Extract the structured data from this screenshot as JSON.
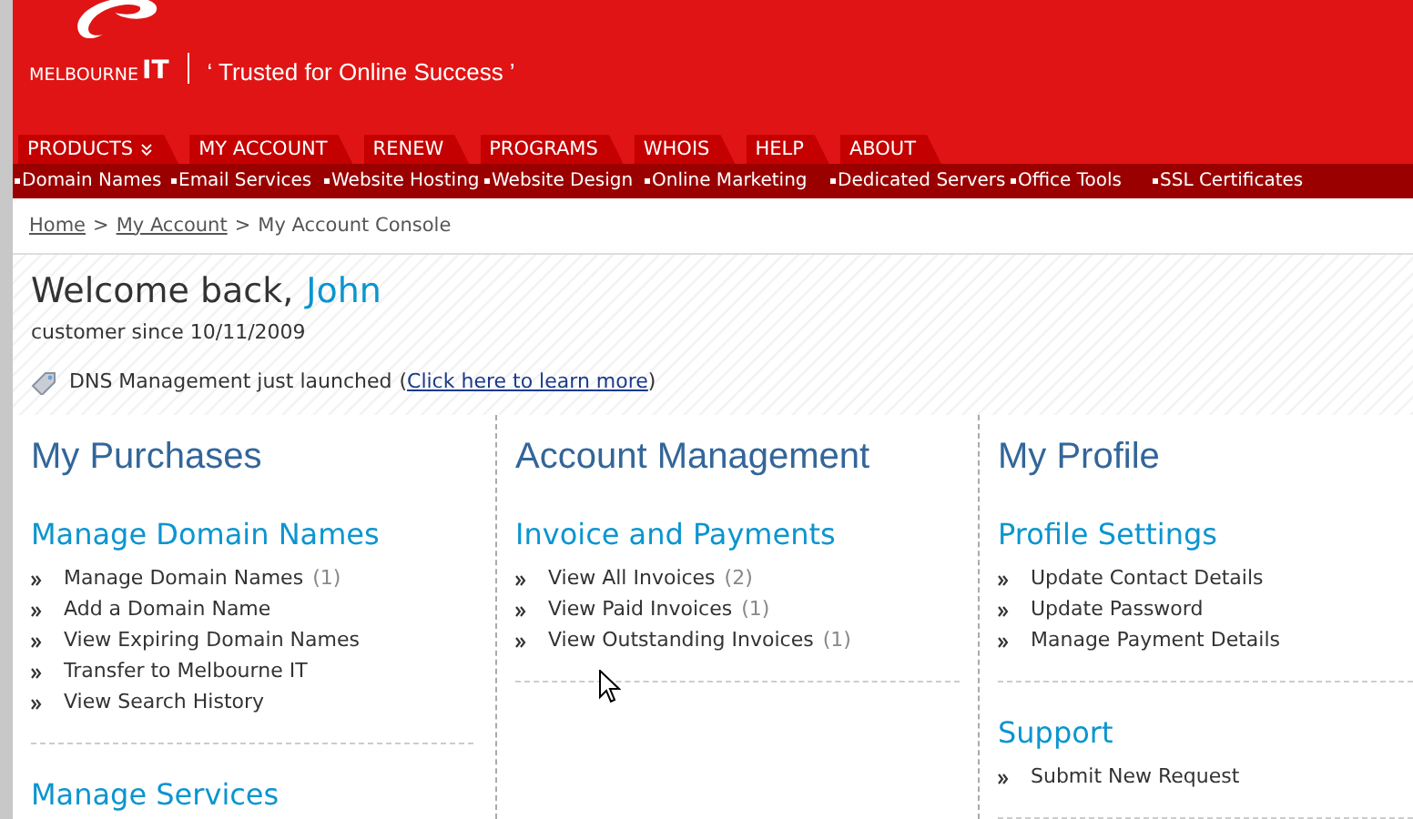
{
  "header": {
    "logo": {
      "name": "MELBOURNE",
      "mark": "IT"
    },
    "tagline": "‘ Trusted for Online Success ’"
  },
  "tabs": [
    {
      "label": "PRODUCTS",
      "dropdown": true
    },
    {
      "label": "MY ACCOUNT",
      "dropdown": false
    },
    {
      "label": "RENEW",
      "dropdown": false
    },
    {
      "label": "PROGRAMS",
      "dropdown": false
    },
    {
      "label": "WHOIS",
      "dropdown": false
    },
    {
      "label": "HELP",
      "dropdown": false
    },
    {
      "label": "ABOUT",
      "dropdown": false
    }
  ],
  "subnav": [
    "Domain Names",
    "Email Services",
    "Website Hosting",
    "Website Design",
    "Online Marketing",
    "Dedicated Servers",
    "Office Tools",
    "SSL Certificates"
  ],
  "breadcrumb": {
    "links": [
      "Home",
      "My Account"
    ],
    "separator": ">",
    "current": "My Account Console"
  },
  "welcome": {
    "greeting": "Welcome back,",
    "name": "John",
    "since": "customer since 10/11/2009",
    "notice": "DNS Management just launched",
    "link_open": "(",
    "link": "Click here to learn more",
    "link_close": ")"
  },
  "columns": [
    {
      "title": "My Purchases",
      "sections": [
        {
          "title": "Manage Domain Names",
          "items": [
            {
              "label": "Manage Domain Names",
              "count": "(1)"
            },
            {
              "label": "Add a Domain Name"
            },
            {
              "label": "View Expiring Domain Names"
            },
            {
              "label": "Transfer to Melbourne IT"
            },
            {
              "label": "View Search History"
            }
          ]
        },
        {
          "title": "Manage Services"
        }
      ]
    },
    {
      "title": "Account Management",
      "sections": [
        {
          "title": "Invoice and Payments",
          "items": [
            {
              "label": "View All Invoices",
              "count": "(2)"
            },
            {
              "label": "View Paid Invoices",
              "count": "(1)"
            },
            {
              "label": "View Outstanding Invoices",
              "count": "(1)"
            }
          ]
        }
      ]
    },
    {
      "title": "My Profile",
      "sections": [
        {
          "title": "Profile Settings",
          "items": [
            {
              "label": "Update Contact Details"
            },
            {
              "label": "Update Password"
            },
            {
              "label": "Manage Payment Details"
            }
          ]
        },
        {
          "title": "Support",
          "items": [
            {
              "label": "Submit New Request"
            }
          ]
        }
      ]
    }
  ]
}
